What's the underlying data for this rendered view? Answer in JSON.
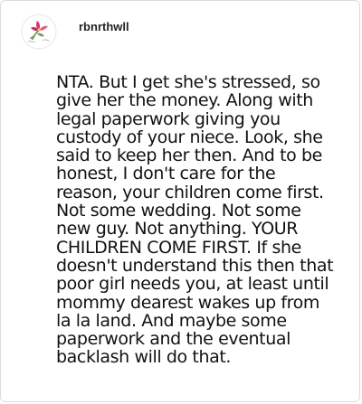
{
  "post": {
    "username": "rbnrthwll",
    "avatar_icon": "flower-avatar-icon",
    "accent_color": "#d23a76",
    "body_lines": [
      "NTA. But I get she's stressed, so",
      "give her the money. Along with",
      "legal paperwork giving you",
      "custody of your niece. Look, she",
      "said to keep her then. And to be",
      "honest, I don't care for the",
      "reason, your children come first.",
      "Not some wedding. Not some",
      "new guy. Not anything. YOUR",
      "CHILDREN COME FIRST. If she",
      "doesn't understand this then that",
      "poor girl needs you, at least until",
      "mommy dearest wakes up from",
      "la la land. And maybe some",
      "paperwork and the eventual",
      "backlash will do that."
    ]
  }
}
